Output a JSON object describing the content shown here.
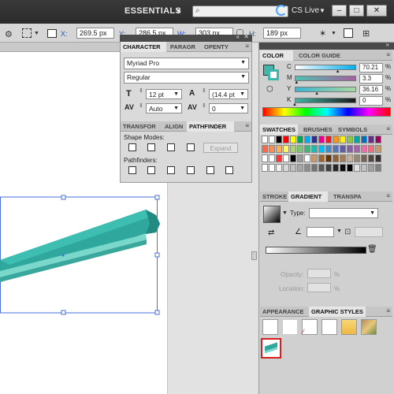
{
  "top_bar": {
    "workspace": "ESSENTIALS",
    "cs_live": "CS Live",
    "window_buttons": [
      "–",
      "□",
      "✕"
    ]
  },
  "control_bar": {
    "x_label": "X:",
    "x_value": "269.5 px",
    "y_label": "Y:",
    "y_value": "286.5 px",
    "w_label": "W:",
    "w_value": "303 px",
    "h_label": "H:",
    "h_value": "189 px"
  },
  "character_panel": {
    "tabs": [
      "CHARACTER",
      "PARAGR",
      "OPENTY"
    ],
    "font_family": "Myriad Pro",
    "font_style": "Regular",
    "font_size": "12 pt",
    "leading": "(14.4 pt",
    "kerning": "Auto",
    "tracking": "0"
  },
  "pathfinder_panel": {
    "tabs": [
      "TRANSFOR",
      "ALIGN",
      "PATHFINDER"
    ],
    "shape_modes_label": "Shape Modes:",
    "expand_label": "Expand",
    "pathfinders_label": "Pathfinders:"
  },
  "color_panel": {
    "tabs": [
      "COLOR",
      "COLOR GUIDE"
    ],
    "channels": [
      {
        "label": "C",
        "value": "70.21",
        "unit": "%",
        "fraction": 0.7,
        "gradient": "linear-gradient(90deg,#ffffff,#00aeef)"
      },
      {
        "label": "M",
        "value": "3.3",
        "unit": "%",
        "fraction": 0.03,
        "gradient": "linear-gradient(90deg,#4ec3b2,#a45fa0)"
      },
      {
        "label": "Y",
        "value": "36.16",
        "unit": "%",
        "fraction": 0.36,
        "gradient": "linear-gradient(90deg,#3ab5d0,#a9d8a0)"
      },
      {
        "label": "K",
        "value": "0",
        "unit": "%",
        "fraction": 0.0,
        "gradient": "linear-gradient(90deg,#3fb5a5,#1a1a1a)"
      }
    ],
    "fill_color": "#3fb8ab"
  },
  "swatches_panel": {
    "tabs": [
      "SWATCHES",
      "BRUSHES",
      "SYMBOLS"
    ]
  },
  "gradient_panel": {
    "tabs": [
      "STROKE",
      "GRADIENT",
      "TRANSPA"
    ],
    "type_label": "Type:",
    "opacity_label": "Opacity:",
    "location_label": "Location:",
    "percent": "%"
  },
  "graphic_styles_panel": {
    "tabs": [
      "APPEARANCE",
      "GRAPHIC STYLES"
    ]
  },
  "colors": {
    "teal": "#2fa79c",
    "teal_light": "#6fd2c6",
    "selection": "#4a6fd8",
    "highlight_red": "#d62020"
  }
}
